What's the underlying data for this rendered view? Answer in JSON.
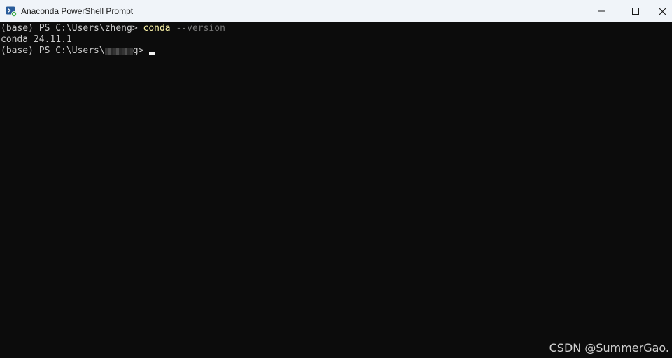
{
  "window": {
    "title": "Anaconda PowerShell Prompt",
    "icon": "powershell-icon"
  },
  "terminal": {
    "line1": {
      "prompt": "(base) PS C:\\Users\\zheng> ",
      "command": "conda",
      "args": " --version"
    },
    "line2": {
      "output": "conda 24.11.1"
    },
    "line3": {
      "prompt_start": "(base) PS C:\\Users\\",
      "prompt_end": "g>"
    }
  },
  "watermark": {
    "text": "CSDN @SummerGao."
  },
  "colors": {
    "background": "#0c0c0c",
    "text": "#cccccc",
    "command": "#f9f1a5",
    "argument": "#767676",
    "titlebar": "#f0f4f9"
  }
}
